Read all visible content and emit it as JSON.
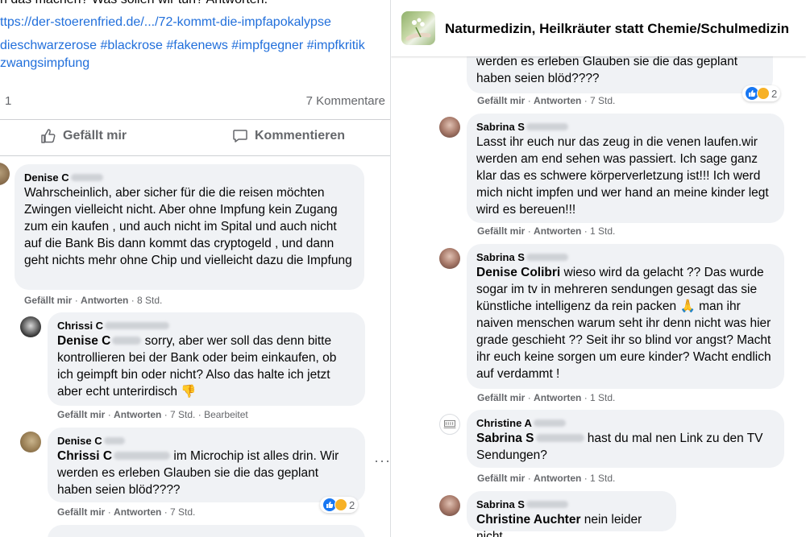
{
  "left": {
    "post_text_cut": "n das machen? Was sollen wir tun? Antworten.",
    "post_link": "ttps://der-stoerenfried.de/.../72-kommt-die-impfapokalypse",
    "hashtags": [
      "dieschwarzerose",
      "#blackrose",
      "#fakenews",
      "#impfgegner",
      "#impfkritik",
      "zwangsimpfung"
    ],
    "like_count": "1",
    "comments_count": "7 Kommentare",
    "like_label": "Gefällt mir",
    "comment_label": "Kommentieren",
    "comments": [
      {
        "author": "Denise C",
        "text": "Wahrscheinlich, aber sicher für die die reisen möchten Zwingen vielleicht nicht. Aber ohne Impfung kein Zugang zum ein kaufen , und auch nicht im Spital und auch nicht auf die Bank Bis dann kommt das cryptogeld , und dann geht nichts mehr ohne Chip und vielleicht dazu die Impfung",
        "like": "Gefällt mir",
        "reply": "Antworten",
        "time": "8 Std."
      },
      {
        "author": "Chrissi C",
        "mention": "Denise C",
        "text": " sorry, aber wer soll das denn bitte kontrollieren bei der Bank oder beim einkaufen, ob ich geimpft bin oder nicht? Also das halte ich jetzt aber echt unterirdisch 👎",
        "like": "Gefällt mir",
        "reply": "Antworten",
        "time": "7 Std.",
        "edited": "Bearbeitet"
      },
      {
        "author": "Denise C",
        "mention": "Chrissi C",
        "text": " im Microchip ist alles drin. Wir werden es erleben Glauben sie die das geplant haben seien blöd????",
        "like": "Gefällt mir",
        "reply": "Antworten",
        "time": "7 Std.",
        "reaction_count": "2"
      }
    ]
  },
  "right": {
    "group_title": "Naturmedizin, Heilkräuter statt Chemie/Schulmedizin",
    "comments": [
      {
        "text": "werden es erleben Glauben sie die das geplant haben seien blöd????",
        "like": "Gefällt mir",
        "reply": "Antworten",
        "time": "7 Std.",
        "reaction_count": "2"
      },
      {
        "author": "Sabrina S",
        "text": "Lasst ihr euch nur das zeug in die venen laufen.wir werden am end sehen was passiert. Ich sage ganz klar das es schwere körperverletzung ist!!! Ich werd mich nicht impfen und wer hand an meine kinder legt wird es bereuen!!!",
        "like": "Gefällt mir",
        "reply": "Antworten",
        "time": "1 Std."
      },
      {
        "author": "Sabrina S",
        "mention": "Denise Colibri",
        "text": " wieso wird da gelacht ?? Das wurde sogar im tv in mehreren sendungen gesagt das sie künstliche intelligenz da rein packen 🙏 man ihr naiven menschen warum seht ihr denn nicht was hier grade geschieht ?? Seit ihr so blind vor angst? Macht ihr euch keine sorgen um eure kinder? Wacht endlich auf verdammt !",
        "like": "Gefällt mir",
        "reply": "Antworten",
        "time": "1 Std."
      },
      {
        "author": "Christine A",
        "mention": "Sabrina S",
        "text": " hast du mal nen Link zu den TV Sendungen?",
        "like": "Gefällt mir",
        "reply": "Antworten",
        "time": "1 Std."
      },
      {
        "author": "Sabrina S",
        "mention": "Christine Auchter",
        "text": " nein leider nicht"
      }
    ]
  },
  "colors": {
    "link": "#216fdb",
    "meta": "#65676b",
    "bubble": "#f0f2f5",
    "like_blue": "#1877f2"
  }
}
